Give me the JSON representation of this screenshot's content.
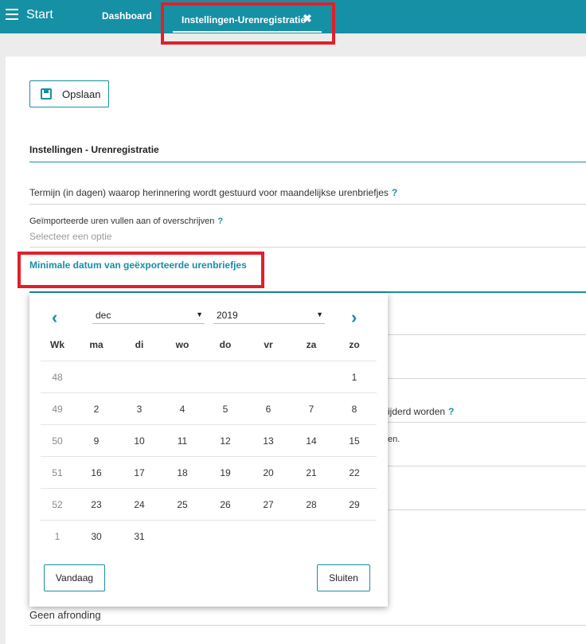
{
  "topbar": {
    "start_label": "Start",
    "tabs": [
      {
        "label": "Dashboard"
      },
      {
        "label": "Instellingen-Urenregistratie",
        "close_icon": "close-icon"
      }
    ]
  },
  "toolbar": {
    "save_label": "Opslaan",
    "save_icon": "floppy-disk-icon"
  },
  "section": {
    "title": "Instellingen - Urenregistratie"
  },
  "fields": {
    "reminder_label": "Termijn (in dagen) waarop herinnering wordt gestuurd voor maandelijkse urenbriefjes",
    "imported_label": "Geïmporteerde uren vullen aan of overschrijven",
    "imported_placeholder": "Selecteer een optie",
    "min_date_label": "Minimale datum van geëxporteerde urenbriefjes",
    "help_symbol": "?"
  },
  "background_fragments": {
    "partial_1": "ijderd worden",
    "partial_2": "en.",
    "rounding_value": "Geen afronding"
  },
  "calendar": {
    "month": "dec",
    "year": "2019",
    "prev_icon": "chevron-left-icon",
    "next_icon": "chevron-right-icon",
    "headers": [
      "Wk",
      "ma",
      "di",
      "wo",
      "do",
      "vr",
      "za",
      "zo"
    ],
    "weeks": [
      [
        "48",
        "",
        "",
        "",
        "",
        "",
        "",
        "1"
      ],
      [
        "49",
        "2",
        "3",
        "4",
        "5",
        "6",
        "7",
        "8"
      ],
      [
        "50",
        "9",
        "10",
        "11",
        "12",
        "13",
        "14",
        "15"
      ],
      [
        "51",
        "16",
        "17",
        "18",
        "19",
        "20",
        "21",
        "22"
      ],
      [
        "52",
        "23",
        "24",
        "25",
        "26",
        "27",
        "28",
        "29"
      ],
      [
        "1",
        "30",
        "31",
        "",
        "",
        "",
        "",
        ""
      ]
    ],
    "today_label": "Vandaag",
    "close_label": "Sluiten"
  },
  "colors": {
    "accent": "#1690a4",
    "highlight": "#e0202a"
  }
}
